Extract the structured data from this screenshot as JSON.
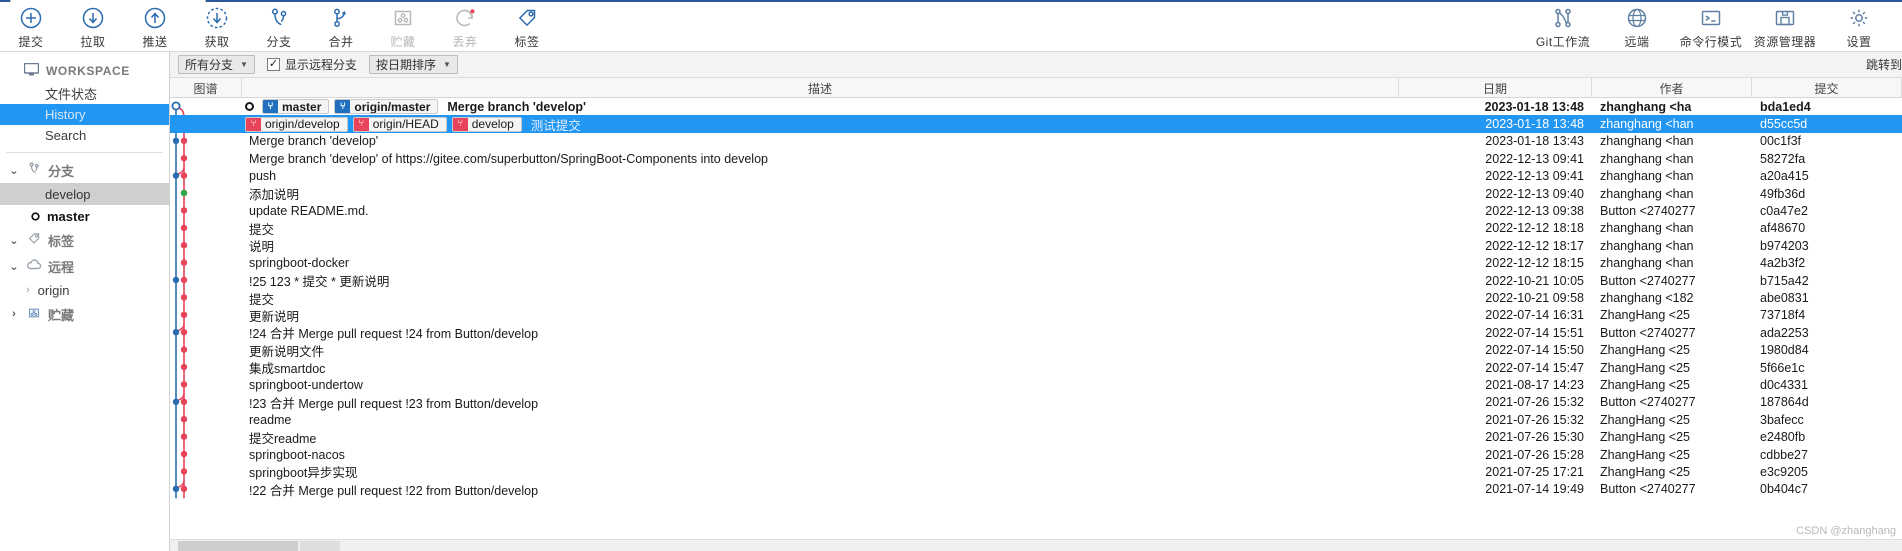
{
  "toolbar": {
    "left_buttons": [
      {
        "label": "提交",
        "icon": "commit-plus-icon",
        "disabled": false
      },
      {
        "label": "拉取",
        "icon": "pull-down-arrow-icon",
        "disabled": false
      },
      {
        "label": "推送",
        "icon": "push-up-arrow-icon",
        "disabled": false
      },
      {
        "label": "获取",
        "icon": "fetch-dashed-arrow-icon",
        "disabled": false
      },
      {
        "label": "分支",
        "icon": "branch-icon",
        "disabled": false
      },
      {
        "label": "合并",
        "icon": "merge-icon",
        "disabled": false
      },
      {
        "label": "贮藏",
        "icon": "stash-icon",
        "disabled": true
      },
      {
        "label": "丢弃",
        "icon": "discard-refresh-icon",
        "disabled": true
      },
      {
        "label": "标签",
        "icon": "tag-icon",
        "disabled": false
      }
    ],
    "right_buttons": [
      {
        "label": "Git工作流",
        "icon": "gitflow-icon"
      },
      {
        "label": "远端",
        "icon": "globe-icon"
      },
      {
        "label": "命令行模式",
        "icon": "terminal-icon"
      },
      {
        "label": "资源管理器",
        "icon": "folder-explorer-icon"
      },
      {
        "label": "设置",
        "icon": "gear-icon"
      }
    ]
  },
  "sidebar": {
    "workspace_label": "WORKSPACE",
    "workspace_icon": "monitor-icon",
    "workspace_items": [
      {
        "label": "文件状态",
        "state": "normal"
      },
      {
        "label": "History",
        "state": "selected"
      },
      {
        "label": "Search",
        "state": "normal"
      }
    ],
    "groups": [
      {
        "label": "分支",
        "icon": "branch-icon",
        "expanded": true,
        "branches": [
          {
            "label": "develop",
            "state": "shaded",
            "current": false
          },
          {
            "label": "master",
            "state": "normal",
            "current": true
          }
        ]
      },
      {
        "label": "标签",
        "icon": "tag-icon",
        "expanded": true,
        "branches": []
      },
      {
        "label": "远程",
        "icon": "cloud-icon",
        "expanded": true,
        "children": [
          {
            "label": "origin",
            "expanded": false
          }
        ]
      },
      {
        "label": "贮藏",
        "icon": "stash-icon",
        "expanded": false,
        "branches": []
      }
    ]
  },
  "filterbar": {
    "branch_filter": "所有分支",
    "show_remote_branches_label": "显示远程分支",
    "show_remote_branches_checked": true,
    "sort_mode": "按日期排序",
    "jump_to_label": "跳转到"
  },
  "table": {
    "headers": {
      "graph": "图谱",
      "description": "描述",
      "date": "日期",
      "author": "作者",
      "commit": "提交"
    },
    "rows": [
      {
        "badges": [
          {
            "text": "master",
            "color": "blue"
          },
          {
            "text": "origin/master",
            "color": "blue"
          }
        ],
        "has_head_dot": true,
        "message": "Merge branch 'develop'",
        "date": "2023-01-18 13:48",
        "author": "zhanghang <ha",
        "commit": "bda1ed4",
        "selected": false,
        "bold": true
      },
      {
        "badges": [
          {
            "text": "origin/develop",
            "color": "red"
          },
          {
            "text": "origin/HEAD",
            "color": "red"
          },
          {
            "text": "develop",
            "color": "red"
          }
        ],
        "has_head_dot": false,
        "message": "测试提交",
        "date": "2023-01-18 13:48",
        "author": "zhanghang <han",
        "commit": "d55cc5d",
        "selected": true,
        "bold": false
      },
      {
        "badges": [],
        "message": "Merge branch 'develop'",
        "date": "2023-01-18 13:43",
        "author": "zhanghang <han",
        "commit": "00c1f3f",
        "selected": false,
        "bold": false
      },
      {
        "badges": [],
        "message": "Merge branch 'develop' of https://gitee.com/superbutton/SpringBoot-Components into develop",
        "date": "2022-12-13 09:41",
        "author": "zhanghang <han",
        "commit": "58272fa",
        "selected": false,
        "bold": false
      },
      {
        "badges": [],
        "message": "push",
        "date": "2022-12-13 09:41",
        "author": "zhanghang <han",
        "commit": "a20a415",
        "selected": false,
        "bold": false
      },
      {
        "badges": [],
        "message": "添加说明",
        "date": "2022-12-13 09:40",
        "author": "zhanghang <han",
        "commit": "49fb36d",
        "selected": false,
        "bold": false
      },
      {
        "badges": [],
        "message": "update README.md.",
        "date": "2022-12-13 09:38",
        "author": "Button <2740277",
        "commit": "c0a47e2",
        "selected": false,
        "bold": false
      },
      {
        "badges": [],
        "message": "提交",
        "date": "2022-12-12 18:18",
        "author": "zhanghang <han",
        "commit": "af48670",
        "selected": false,
        "bold": false
      },
      {
        "badges": [],
        "message": "说明",
        "date": "2022-12-12 18:17",
        "author": "zhanghang <han",
        "commit": "b974203",
        "selected": false,
        "bold": false
      },
      {
        "badges": [],
        "message": "springboot-docker",
        "date": "2022-12-12 18:15",
        "author": "zhanghang <han",
        "commit": "4a2b3f2",
        "selected": false,
        "bold": false
      },
      {
        "badges": [],
        "message": "!25 123 * 提交 * 更新说明",
        "date": "2022-10-21 10:05",
        "author": "Button <2740277",
        "commit": "b715a42",
        "selected": false,
        "bold": false
      },
      {
        "badges": [],
        "message": "提交",
        "date": "2022-10-21 09:58",
        "author": "zhanghang <182",
        "commit": "abe0831",
        "selected": false,
        "bold": false
      },
      {
        "badges": [],
        "message": "更新说明",
        "date": "2022-07-14 16:31",
        "author": "ZhangHang <25",
        "commit": "73718f4",
        "selected": false,
        "bold": false
      },
      {
        "badges": [],
        "message": "!24 合并 Merge pull request !24 from Button/develop",
        "date": "2022-07-14 15:51",
        "author": "Button <2740277",
        "commit": "ada2253",
        "selected": false,
        "bold": false
      },
      {
        "badges": [],
        "message": "更新说明文件",
        "date": "2022-07-14 15:50",
        "author": "ZhangHang <25",
        "commit": "1980d84",
        "selected": false,
        "bold": false
      },
      {
        "badges": [],
        "message": "集成smartdoc",
        "date": "2022-07-14 15:47",
        "author": "ZhangHang <25",
        "commit": "5f66e1c",
        "selected": false,
        "bold": false
      },
      {
        "badges": [],
        "message": "springboot-undertow",
        "date": "2021-08-17 14:23",
        "author": "ZhangHang <25",
        "commit": "d0c4331",
        "selected": false,
        "bold": false
      },
      {
        "badges": [],
        "message": "!23 合并 Merge pull request !23 from Button/develop",
        "date": "2021-07-26 15:32",
        "author": "Button <2740277",
        "commit": "187864d",
        "selected": false,
        "bold": false
      },
      {
        "badges": [],
        "message": "readme",
        "date": "2021-07-26 15:32",
        "author": "ZhangHang <25",
        "commit": "3bafecc",
        "selected": false,
        "bold": false
      },
      {
        "badges": [],
        "message": "提交readme",
        "date": "2021-07-26 15:30",
        "author": "ZhangHang <25",
        "commit": "e2480fb",
        "selected": false,
        "bold": false
      },
      {
        "badges": [],
        "message": "springboot-nacos",
        "date": "2021-07-26 15:28",
        "author": "ZhangHang <25",
        "commit": "cdbbe27",
        "selected": false,
        "bold": false
      },
      {
        "badges": [],
        "message": "springboot异步实现",
        "date": "2021-07-25 17:21",
        "author": "ZhangHang <25",
        "commit": "e3c9205",
        "selected": false,
        "bold": false
      },
      {
        "badges": [],
        "message": "!22 合并 Merge pull request !22 from Button/develop",
        "date": "2021-07-14 19:49",
        "author": "Button <2740277",
        "commit": "0b404c7",
        "selected": false,
        "bold": false
      }
    ]
  },
  "watermark": "CSDN @zhanghang"
}
